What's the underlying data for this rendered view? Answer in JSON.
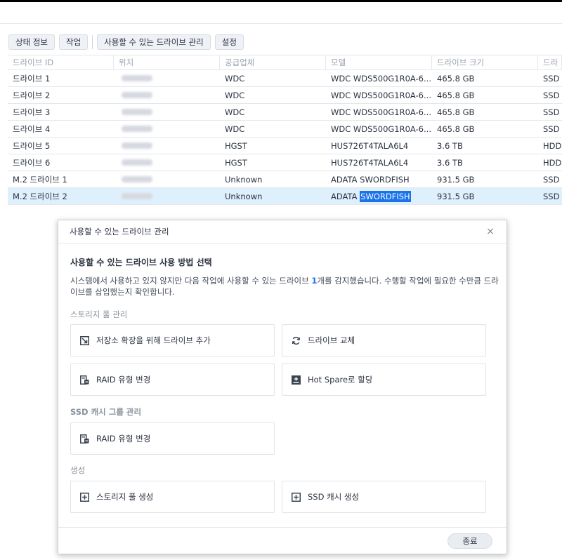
{
  "toolbar": {
    "status_info": "상태 정보",
    "action": "작업",
    "manage_available": "사용할 수 있는 드라이브 관리",
    "settings": "설정"
  },
  "grid": {
    "headers": [
      "드라이브 ID",
      "위치",
      "공급업체",
      "모델",
      "드라이브 크기",
      "드라"
    ],
    "rows": [
      {
        "id": "드라이브 1",
        "vendor": "WDC",
        "model": "WDC WDS500G1R0A-6...",
        "size": "465.8 GB",
        "type": "SSD"
      },
      {
        "id": "드라이브 2",
        "vendor": "WDC",
        "model": "WDC WDS500G1R0A-6...",
        "size": "465.8 GB",
        "type": "SSD"
      },
      {
        "id": "드라이브 3",
        "vendor": "WDC",
        "model": "WDC WDS500G1R0A-6...",
        "size": "465.8 GB",
        "type": "SSD"
      },
      {
        "id": "드라이브 4",
        "vendor": "WDC",
        "model": "WDC WDS500G1R0A-6...",
        "size": "465.8 GB",
        "type": "SSD"
      },
      {
        "id": "드라이브 5",
        "vendor": "HGST",
        "model": "HUS726T4TALA6L4",
        "size": "3.6 TB",
        "type": "HDD"
      },
      {
        "id": "드라이브 6",
        "vendor": "HGST",
        "model": "HUS726T4TALA6L4",
        "size": "3.6 TB",
        "type": "HDD"
      },
      {
        "id": "M.2 드라이브 1",
        "vendor": "Unknown",
        "model": "ADATA SWORDFISH",
        "size": "931.5 GB",
        "type": "SSD"
      },
      {
        "id": "M.2 드라이브 2",
        "vendor": "Unknown",
        "model_prefix": "ADATA ",
        "model_highlight": "SWORDFISH",
        "size": "931.5 GB",
        "type": "SSD"
      }
    ]
  },
  "modal": {
    "title": "사용할 수 있는 드라이브 관리",
    "close_glyph": "×",
    "heading": "사용할 수 있는 드라이브 사용 방법 선택",
    "desc_part1": "시스템에서 사용하고 있지 않지만 다음 작업에 사용할 수 있는 드라이브 ",
    "desc_count": "1",
    "desc_part2": "개를 감지했습니다. 수행할 작업에 필요한 수만큼 드라이브를 삽입했는지 확인합니다.",
    "section_pool": "스토리지 풀 관리",
    "add_drive": "저장소 확장을 위해 드라이브 추가",
    "replace_drive": "드라이브 교체",
    "change_raid": "RAID 유형 변경",
    "hot_spare": "Hot Spare로 할당",
    "section_ssd": "SSD 캐시 그룹 관리",
    "change_raid_ssd": "RAID 유형 변경",
    "section_create": "생성",
    "create_pool": "스토리지 풀 생성",
    "create_ssd_cache": "SSD 캐시 생성",
    "close_button": "종료"
  },
  "colors": {
    "accent": "#1a73e8",
    "selected_row": "#dff0fd"
  }
}
